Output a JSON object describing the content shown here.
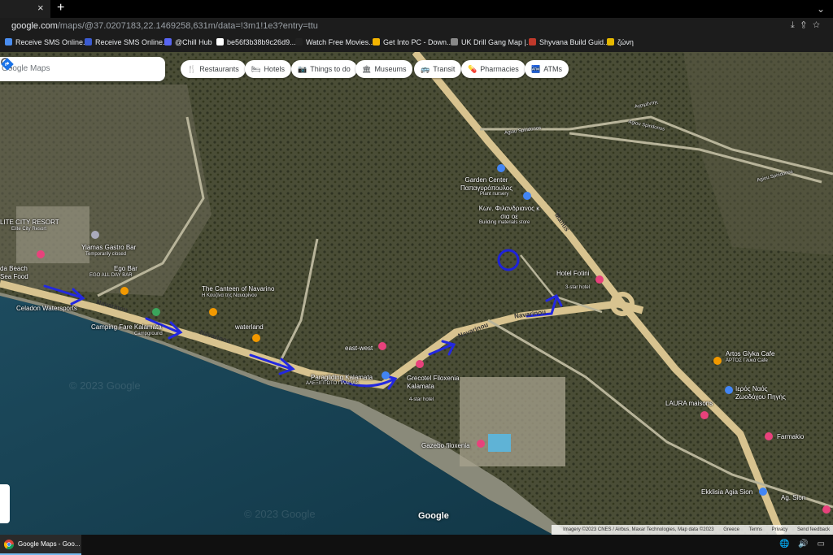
{
  "browser": {
    "tab_close": "×",
    "new_tab": "+",
    "window_control": "⌄",
    "url_host": "google.com",
    "url_path": "/maps/@37.0207183,22.1469258,631m/data=!3m1!1e3?entry=ttu",
    "bookmarks": [
      {
        "label": "Receive SMS Online...",
        "color": "#4a8df0"
      },
      {
        "label": "Receive SMS Online...",
        "color": "#3b5bd1"
      },
      {
        "label": "@Chill Hub",
        "color": "#5865f2"
      },
      {
        "label": "be56f3b38b9c26d9....",
        "color": "#ffffff"
      },
      {
        "label": "Watch Free Movies...",
        "color": "#222222"
      },
      {
        "label": "Get Into PC - Down...",
        "color": "#f4b400"
      },
      {
        "label": "UK Drill Gang Map |...",
        "color": "#888888"
      },
      {
        "label": "Shyvana Build Guid...",
        "color": "#c0392b"
      },
      {
        "label": "ζώνη",
        "color": "#e6b800"
      }
    ]
  },
  "maps": {
    "search_placeholder": "Google Maps",
    "chips": [
      {
        "label": "Restaurants",
        "icon": "🍴"
      },
      {
        "label": "Hotels",
        "icon": "🛏"
      },
      {
        "label": "Things to do",
        "icon": "📷"
      },
      {
        "label": "Museums",
        "icon": "🏛"
      },
      {
        "label": "Transit",
        "icon": "🚌"
      },
      {
        "label": "Pharmacies",
        "icon": "💊"
      },
      {
        "label": "ATMs",
        "icon": "🏧"
      }
    ],
    "places": [
      {
        "name": "LITE CITY RESORT",
        "sub": "Elite City Resort"
      },
      {
        "name": "Yiamas Gastro Bar",
        "sub": "Temporarily closed"
      },
      {
        "name": "Ego Bar",
        "sub": "EGO ALL DAY BAR"
      },
      {
        "name": "da Beach",
        "sub": "Sea Food"
      },
      {
        "name": "Celadon Watersports",
        "sub": ""
      },
      {
        "name": "Camping Fare Kalamata",
        "sub": "Campground"
      },
      {
        "name": "The Canteen of Navarino",
        "sub": "Η Κουζίνα της Ναυαρίνου"
      },
      {
        "name": "waterland",
        "sub": ""
      },
      {
        "name": "east-west",
        "sub": ""
      },
      {
        "name": "Paragliding Kalamata",
        "sub": "ΑΛΕΞΙΠΤΩΤΟ ΠΛΑΓΙΑΣ"
      },
      {
        "name": "Grecotel Filoxenia Kalamata",
        "sub": "4-star hotel"
      },
      {
        "name": "Gazebo filoxenia",
        "sub": ""
      },
      {
        "name": "Garden Center Παπαγυρόπουλος",
        "sub": "Plant nursery"
      },
      {
        "name": "Κων. Φιλανδριανος κ σια οε",
        "sub": "Building materials store"
      },
      {
        "name": "Hotel Fotini",
        "sub": "3-star hotel"
      },
      {
        "name": "Artos Glyka Cafe",
        "sub": "ΑΡΤΟΣ Γλυκά Cafe"
      },
      {
        "name": "Ιερός Ναός Ζωοδόχου Πηγής",
        "sub": ""
      },
      {
        "name": "LAURA maisons",
        "sub": ""
      },
      {
        "name": "Farmakio",
        "sub": ""
      },
      {
        "name": "Ekklisia Agia Sion",
        "sub": ""
      },
      {
        "name": "Ag. Sion",
        "sub": ""
      }
    ],
    "roads": {
      "navarinou": "Navarinou",
      "mantis": "Mantis",
      "agrimentis": "Αγριμέντης",
      "agiou_spiridonos": "Agiou Spiridonos"
    },
    "google_logo": "Google",
    "watermark": "© 2023 Google",
    "attribution": "Imagery ©2023 CNES / Airbus, Maxar Technologies, Map data ©2023",
    "footer_links": [
      "Greece",
      "Terms",
      "Privacy",
      "Send feedback"
    ]
  },
  "taskbar": {
    "app_label": "Google Maps - Goo...",
    "tray_icons": "🌐 🔊 ▭"
  }
}
